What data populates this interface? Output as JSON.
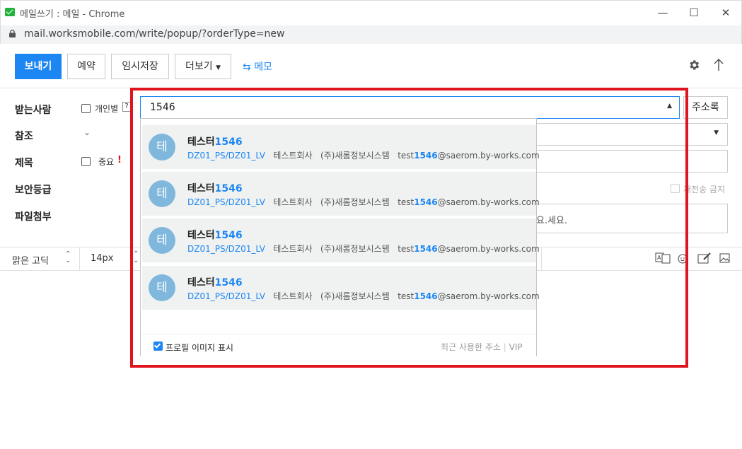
{
  "window": {
    "title": "메일쓰기 : 메일 - Chrome",
    "url": "mail.worksmobile.com/write/popup/?orderType=new"
  },
  "toolbar": {
    "send": "보내기",
    "reserve": "예약",
    "temp_save": "임시저장",
    "more": "더보기",
    "memo": "메모"
  },
  "form": {
    "to_label": "받는사람",
    "individual_label": "개인별",
    "help_mark": "?",
    "to_input_value": "1546",
    "address_book": "주소록",
    "cc_label": "참조",
    "subject_label": "제목",
    "important_label": "중요",
    "important_mark": "!",
    "security_label": "보안등급",
    "forward_block_label": "재전송 금지",
    "attach_label": "파일첨부",
    "attach_hint": "요.세요."
  },
  "editor": {
    "font_name": "맑은 고딕",
    "font_size": "14px"
  },
  "autocomplete": {
    "results": [
      {
        "avatar": "테",
        "name": "테스터",
        "name_hl": "1546",
        "dept": "DZ01_PS/DZ01_LV",
        "company": "테스트회사",
        "org": "(주)새롬정보시스템",
        "email_pre": "test",
        "email_hl": "1546",
        "email_post": "@saerom.by-works.com"
      },
      {
        "avatar": "테",
        "name": "테스터",
        "name_hl": "1546",
        "dept": "DZ01_PS/DZ01_LV",
        "company": "테스트회사",
        "org": "(주)새롬정보시스템",
        "email_pre": "test",
        "email_hl": "1546",
        "email_post": "@saerom.by-works.com"
      },
      {
        "avatar": "테",
        "name": "테스터",
        "name_hl": "1546",
        "dept": "DZ01_PS/DZ01_LV",
        "company": "테스트회사",
        "org": "(주)새롬정보시스템",
        "email_pre": "test",
        "email_hl": "1546",
        "email_post": "@saerom.by-works.com"
      },
      {
        "avatar": "테",
        "name": "테스터",
        "name_hl": "1546",
        "dept": "DZ01_PS/DZ01_LV",
        "company": "테스트회사",
        "org": "(주)새롬정보시스템",
        "email_pre": "test",
        "email_hl": "1546",
        "email_post": "@saerom.by-works.com"
      }
    ],
    "show_profile_label": "프로필 이미지 표시",
    "recent_label": "최근 사용한 주소",
    "separator": "|",
    "vip_label": "VIP"
  },
  "colors": {
    "accent": "#1c86f2",
    "highlight_box": "#e0141c",
    "avatar": "#7fb8dc"
  }
}
